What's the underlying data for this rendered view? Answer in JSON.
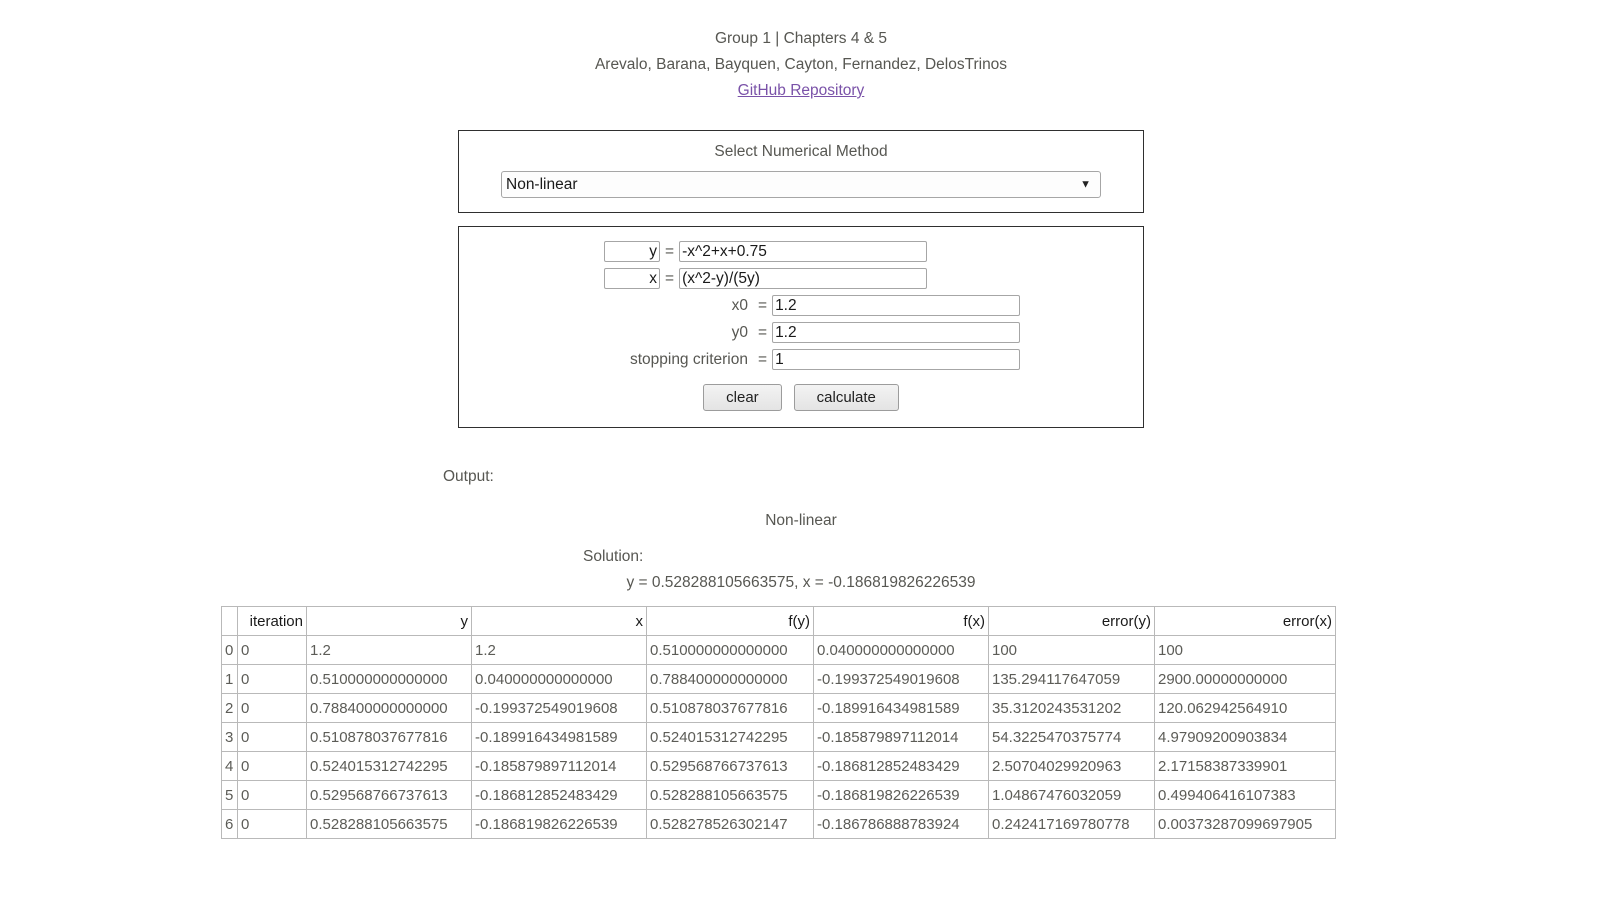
{
  "header": {
    "line1": "Group 1 | Chapters 4 & 5",
    "line2": "Arevalo, Barana, Bayquen, Cayton, Fernandez, DelosTrinos",
    "link": "GitHub Repository"
  },
  "method_panel": {
    "title": "Select Numerical Method",
    "selected": "Non-linear",
    "options": [
      "Non-linear"
    ],
    "chevron_icon": "chevron-down-icon"
  },
  "form": {
    "rows": [
      {
        "name": "y-function",
        "label_value": "y",
        "eq": "=",
        "value": "-x^2+x+0.75",
        "label_is_input": true
      },
      {
        "name": "x-function",
        "label_value": "x",
        "eq": "=",
        "value": "(x^2-y)/(5y)",
        "label_is_input": true
      },
      {
        "name": "x0",
        "label_value": "x0",
        "eq": "=",
        "value": "1.2",
        "label_is_input": false
      },
      {
        "name": "y0",
        "label_value": "y0",
        "eq": "=",
        "value": "1.2",
        "label_is_input": false
      },
      {
        "name": "stopping-criterion",
        "label_value": "stopping criterion",
        "eq": "=",
        "value": "1",
        "label_is_input": false
      }
    ],
    "clear_label": "clear",
    "calculate_label": "calculate"
  },
  "output": {
    "label": "Output:",
    "method": "Non-linear",
    "solution_label": "Solution:",
    "solution_value": "y = 0.528288105663575, x = -0.186819826226539"
  },
  "table": {
    "columns": [
      "",
      "iteration",
      "y",
      "x",
      "f(y)",
      "f(x)",
      "error(y)",
      "error(x)"
    ],
    "rows": [
      [
        "0",
        "0",
        "1.2",
        "1.2",
        "0.510000000000000",
        "0.040000000000000",
        "100",
        "100"
      ],
      [
        "1",
        "0",
        "0.510000000000000",
        "0.040000000000000",
        "0.788400000000000",
        "-0.199372549019608",
        "135.294117647059",
        "2900.00000000000"
      ],
      [
        "2",
        "0",
        "0.788400000000000",
        "-0.199372549019608",
        "0.510878037677816",
        "-0.189916434981589",
        "35.3120243531202",
        "120.062942564910"
      ],
      [
        "3",
        "0",
        "0.510878037677816",
        "-0.189916434981589",
        "0.524015312742295",
        "-0.185879897112014",
        "54.3225470375774",
        "4.97909200903834"
      ],
      [
        "4",
        "0",
        "0.524015312742295",
        "-0.185879897112014",
        "0.529568766737613",
        "-0.186812852483429",
        "2.50704029920963",
        "2.17158387339901"
      ],
      [
        "5",
        "0",
        "0.529568766737613",
        "-0.186812852483429",
        "0.528288105663575",
        "-0.186819826226539",
        "1.04867476032059",
        "0.499406416107383"
      ],
      [
        "6",
        "0",
        "0.528288105663575",
        "-0.186819826226539",
        "0.528278526302147",
        "-0.186786888783924",
        "0.242417169780778",
        "0.00373287099697905"
      ]
    ]
  },
  "colors": {
    "link": "#7a52a8",
    "text": "#575752",
    "border": "#2f2f2f"
  }
}
